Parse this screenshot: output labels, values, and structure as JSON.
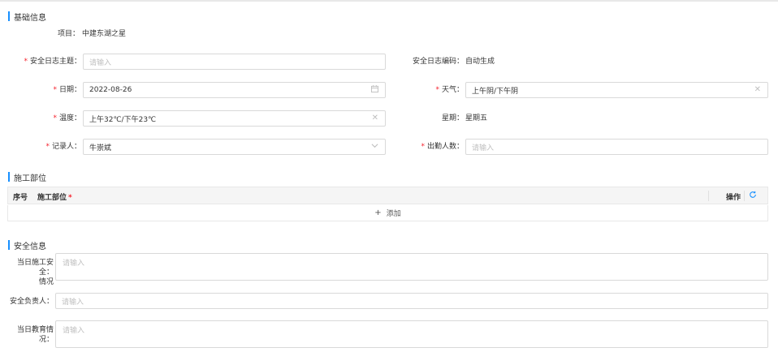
{
  "sections": {
    "basic": "基础信息",
    "construction": "施工部位",
    "safety": "安全信息"
  },
  "project": {
    "label": "项目：",
    "value": "中建东湖之星"
  },
  "form": {
    "subject": {
      "label": "安全日志主题：",
      "placeholder": "请输入"
    },
    "code": {
      "label": "安全日志编码：",
      "value": "自动生成"
    },
    "date": {
      "label": "日期：",
      "value": "2022-08-26",
      "icon": "calendar-icon"
    },
    "weather": {
      "label": "天气：",
      "value": "上午阴/下午阴",
      "icon": "clear-icon"
    },
    "temperature": {
      "label": "温度：",
      "value": "上午32℃/下午23℃",
      "icon": "clear-icon"
    },
    "weekday": {
      "label": "星期：",
      "value": "星期五"
    },
    "recorder": {
      "label": "记录人：",
      "value": "牛崇斌",
      "icon": "chevron-down-icon"
    },
    "attendance": {
      "label": "出勤人数：",
      "placeholder": "请输入"
    }
  },
  "table": {
    "col_index": "序号",
    "col_part": "施工部位",
    "col_action": "操作",
    "add_label": "添加"
  },
  "safety": {
    "situation_label": "当日施工安全情况",
    "situation_label_line1": "当日施工安全：",
    "situation_label_line2": "情况",
    "situation_placeholder": "请输入",
    "owner_label": "安全负责人：",
    "owner_placeholder": "请输入",
    "education_label": "当日教育情况：",
    "education_placeholder": "请输入"
  },
  "colors": {
    "accent": "#1890ff",
    "required": "#f5222d",
    "border": "#d9d9d9",
    "placeholder": "#bfbfbf"
  }
}
